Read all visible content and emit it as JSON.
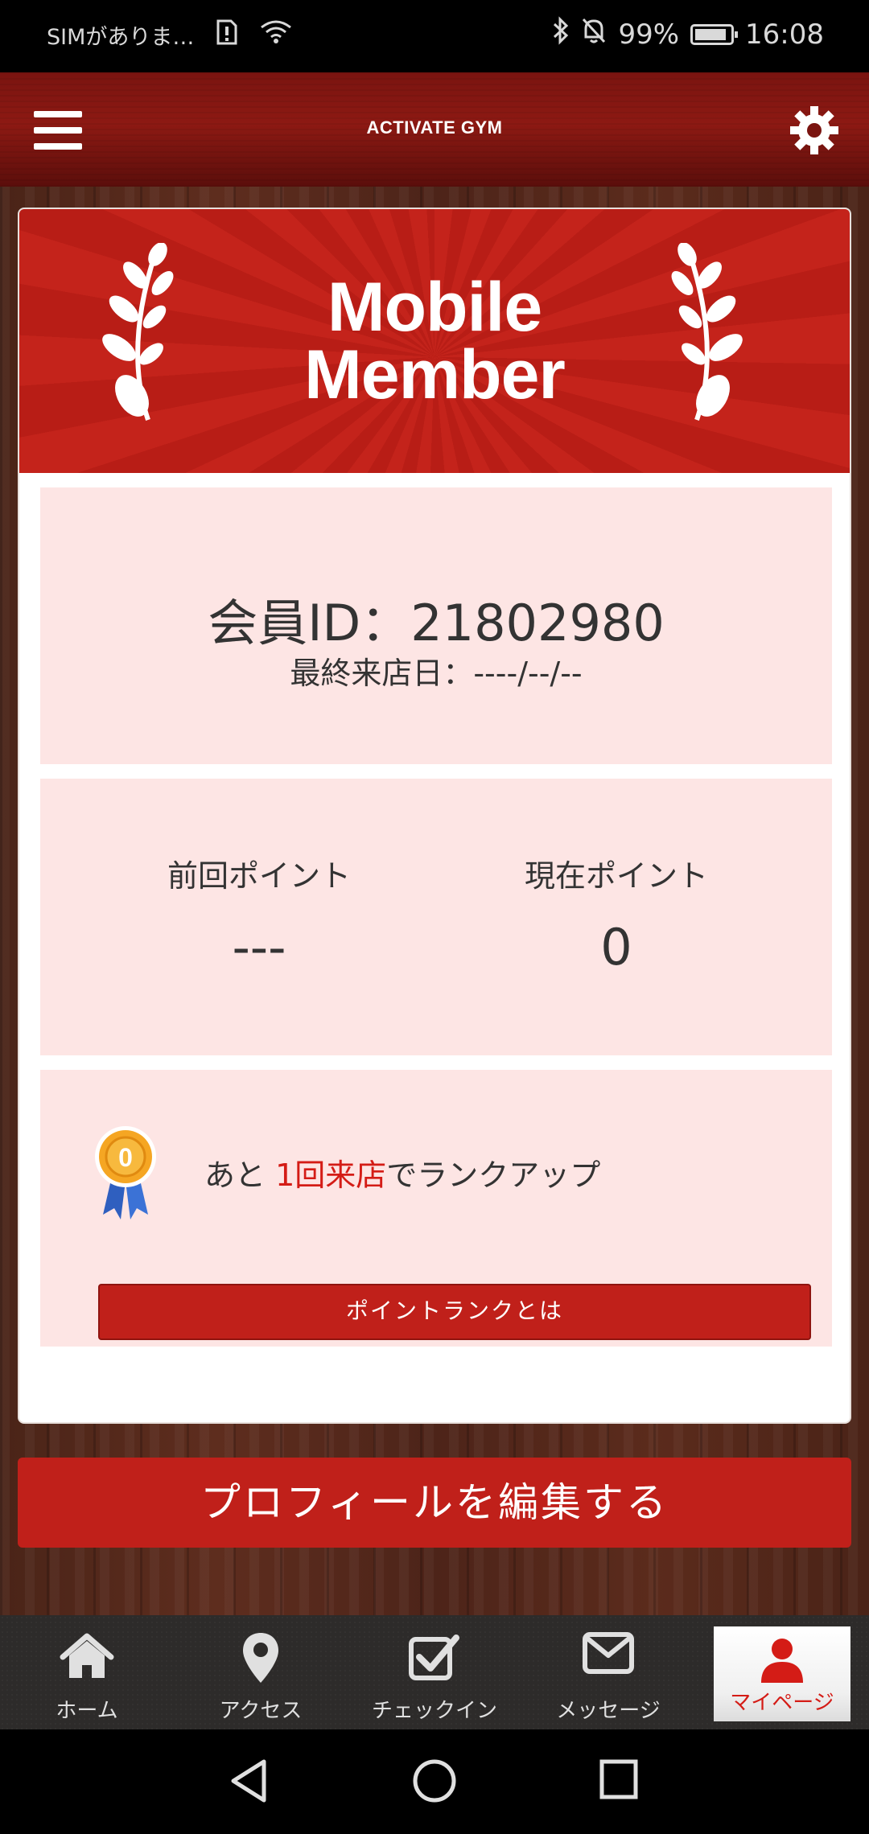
{
  "status_bar": {
    "carrier": "SIMがありま…",
    "battery": "99%",
    "time": "16:08"
  },
  "header": {
    "title": "ACTIVATE GYM"
  },
  "banner": {
    "line1": "Mobile",
    "line2": "Member"
  },
  "member": {
    "id_text": "会員ID：21802980",
    "last_visit_text": "最終来店日：----/--/--"
  },
  "points": {
    "previous_label": "前回ポイント",
    "previous_value": "---",
    "current_label": "現在ポイント",
    "current_value": "0"
  },
  "rank": {
    "medal_number": "0",
    "msg_prefix": "あと ",
    "msg_highlight": "1回来店",
    "msg_suffix": "でランクアップ",
    "button_label": "ポイントランクとは"
  },
  "edit_profile_label": "プロフィールを編集する",
  "bottom_nav": {
    "items": [
      {
        "label": "ホーム",
        "icon": "home-icon"
      },
      {
        "label": "アクセス",
        "icon": "map-pin-icon"
      },
      {
        "label": "チェックイン",
        "icon": "checkbox-icon"
      },
      {
        "label": "メッセージ",
        "icon": "envelope-icon"
      },
      {
        "label": "マイページ",
        "icon": "user-icon"
      }
    ],
    "active_index": 4
  },
  "colors": {
    "accent": "#c0201a",
    "highlight_text": "#d41c16",
    "panel_bg": "#fde5e4"
  }
}
